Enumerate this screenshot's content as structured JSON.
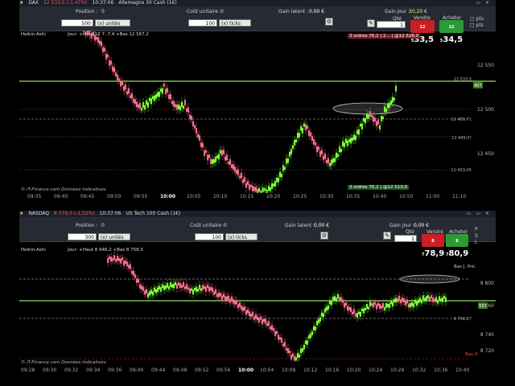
{
  "panel1": {
    "title_symbol": "DAX",
    "title_price": "12 533,5 (-1,47%)",
    "title_time": "10:37:06",
    "title_name": "Allemagne 30 Cash (1€)",
    "position_label": "Position :",
    "position_value": "0",
    "cout_label": "Coût unitaire :",
    "cout_value": "0",
    "gain_label": "Gain latent :",
    "gain_value": "0,00 €",
    "gainjour_label": "Gain jour :",
    "gainjour_value": "30,20 €",
    "qte_label": "Qté",
    "qte_value": "1",
    "vendre_label": "Vendre",
    "vendre_small": "12 5",
    "vendre_big": "33,5",
    "acheter_label": "Acheter",
    "acheter_small": "12 5",
    "acheter_big": "34,5",
    "qty_units": "500",
    "units_select": "(x) unités",
    "ticks_value": "100",
    "ticks_select": "(x) ticks",
    "pts": "pts",
    "indicator": "Heikin-Ashi",
    "jour_text": "Jour: +Haut 12 7..7,4 +Bas 12 567,2",
    "orders_top": "3 ordres 76,2 | 2... | @12 528,0",
    "orders_bottom": "3 ordres 76,2 | @12 513,0",
    "yticks": [
      "12 550",
      "12 500",
      "12 450"
    ],
    "level_labels": [
      "12 533,5",
      "12 489,71",
      "12 469,0?",
      "12 403,05"
    ],
    "xticks": [
      "09:35",
      "09:40",
      "09:45",
      "09:50",
      "09:55",
      "10:00",
      "10:05",
      "10:10",
      "10:15",
      "10:20",
      "10:25",
      "10:30",
      "10:35",
      "10:40",
      "10:50",
      "11:00",
      "11:10"
    ],
    "copyright": "© IT-Finance.com Données indicatives"
  },
  "panel2": {
    "title_symbol": "NASDAQ",
    "title_price": "8 779,0 (-1,32%)",
    "title_time": "10:37:06",
    "title_name": "US Tech 100 Cash (1€)",
    "position_label": "Position :",
    "position_value": "0",
    "cout_label": "Coût unitaire :",
    "cout_value": "0",
    "gain_label": "Gain latent :",
    "gain_value": "0,00 €",
    "gainjour_label": "Gain jour :",
    "gainjour_value": "0,00 €",
    "qte_label": "Qté",
    "qte_value": "1",
    "vendre_label": "Vendre",
    "vendre_small": "8 7",
    "vendre_big": "78,9",
    "acheter_label": "Acheter",
    "acheter_small": "8 7",
    "acheter_big": "80,9",
    "qty_units": "300",
    "units_select": "(x) unités",
    "ticks_value": "100",
    "ticks_select": "(x) ticks",
    "pts": "pts",
    "indicator": "Heikin-Ashi",
    "jour_text": "Jour: +Haut 8 946,2 +Bas 8 758,5",
    "bas_label": "Bas J. Pré.",
    "bas_h": "Bas H",
    "yticks": [
      "8 800",
      "8 760",
      "8 740",
      "8 720"
    ],
    "level_labels": [
      "8 779",
      "8 758,57"
    ],
    "xticks": [
      "09:28",
      "09:30",
      "09:32",
      "09:34",
      "09:36",
      "09:40",
      "09:44",
      "09:48",
      "09:52",
      "09:56",
      "10:00",
      "10:04",
      "10:08",
      "10:12",
      "10:16",
      "10:20",
      "10:24",
      "10:28",
      "10:32",
      "10:36",
      "10:40"
    ],
    "copyright": "© IT-Finance.com Données indicatives"
  }
}
